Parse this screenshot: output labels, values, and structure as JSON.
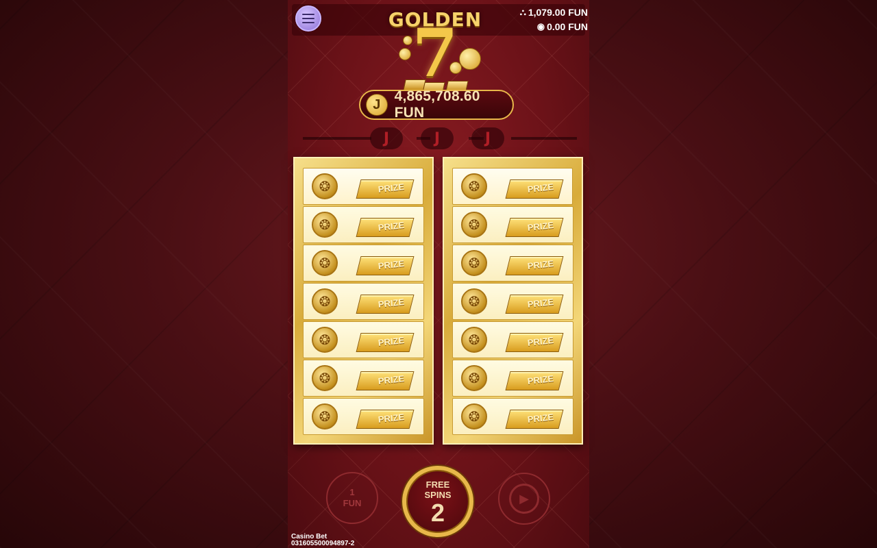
{
  "header": {
    "menu_icon": "hamburger-menu-icon",
    "balance": "1,079.00 FUN",
    "bonus_balance": "0.00 FUN",
    "balance_icon": "coin-stack-icon",
    "bonus_icon": "bonus-chips-icon"
  },
  "logo": {
    "word": "GOLDEN",
    "numeral": "7"
  },
  "jackpot": {
    "icon_letter": "J",
    "amount": "4,865,708.60 FUN"
  },
  "jackpot_slots": [
    "J",
    "J",
    "J"
  ],
  "grid": {
    "columns": [
      {
        "tiles": [
          "PRIZE",
          "PRIZE",
          "PRIZE",
          "PRIZE",
          "PRIZE",
          "PRIZE",
          "PRIZE"
        ]
      },
      {
        "tiles": [
          "PRIZE",
          "PRIZE",
          "PRIZE",
          "PRIZE",
          "PRIZE",
          "PRIZE",
          "PRIZE"
        ]
      }
    ],
    "tile_icon": "lion-medallion-icon"
  },
  "controls": {
    "bet_amount": "1",
    "bet_unit": "FUN",
    "spin_label_line1": "FREE",
    "spin_label_line2": "SPINS",
    "free_spins_count": "2",
    "autoplay_icon": "autoplay-icon"
  },
  "footer": {
    "title": "Casino Bet",
    "id": "031605500094897-2"
  },
  "colors": {
    "background": "#4a0f14",
    "gold": "#e8b84a",
    "panel": "#6b1218",
    "menu": "#b39ae8"
  }
}
